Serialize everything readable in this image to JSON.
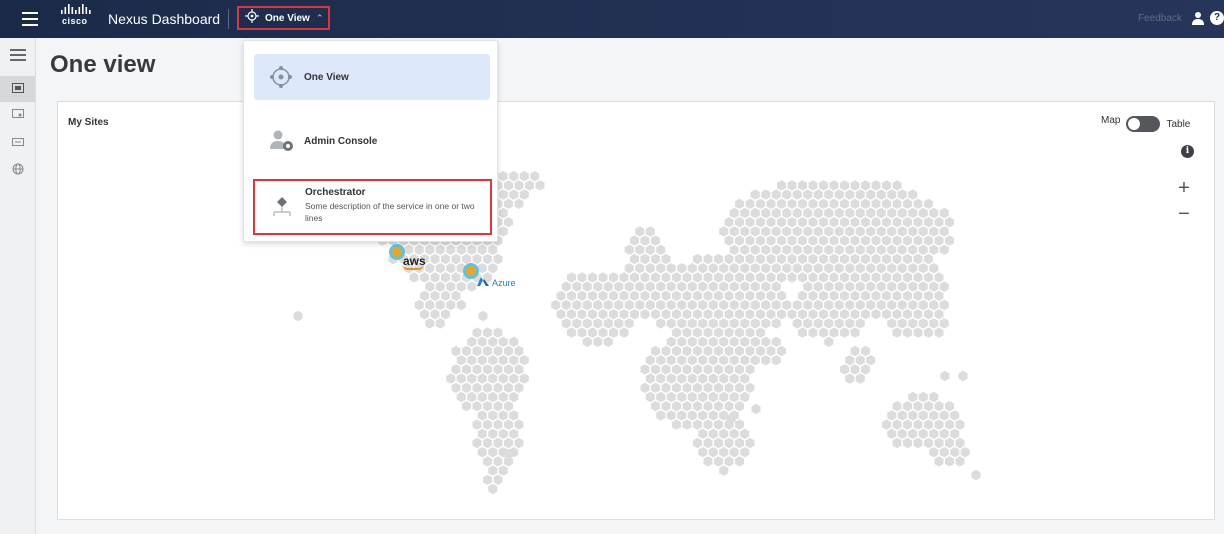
{
  "header": {
    "logo_text": "cisco",
    "app_title": "Nexus Dashboard",
    "view_switcher_label": "One View",
    "feedback_label": "Feedback",
    "help_label": "?"
  },
  "page": {
    "title": "One view"
  },
  "dropdown": {
    "items": [
      {
        "label": "One View",
        "icon": "one-view-icon"
      },
      {
        "label": "Admin Console",
        "icon": "admin-console-icon"
      },
      {
        "label": "Orchestrator",
        "description": "Some description of the service in one or two lines",
        "icon": "orchestrator-icon"
      }
    ]
  },
  "sites_card": {
    "title": "My Sites",
    "toggle_left_label": "Map",
    "toggle_right_label": "Table",
    "info_label": "i",
    "zoom_in_label": "+",
    "zoom_out_label": "−",
    "sites": [
      {
        "name": "aws",
        "label": "aws"
      },
      {
        "name": "azure",
        "label": "Azure"
      }
    ]
  },
  "colors": {
    "header_bg": "#1c2a4a",
    "highlight_border": "#d9363e",
    "selected_item_bg": "#dde9fb",
    "site_pin_fill": "#e6a823",
    "site_pin_ring": "#5cc3e6",
    "map_hex": "#dcdcdc",
    "azure_blue": "#2a7bd4",
    "aws_orange": "#e8902a"
  }
}
